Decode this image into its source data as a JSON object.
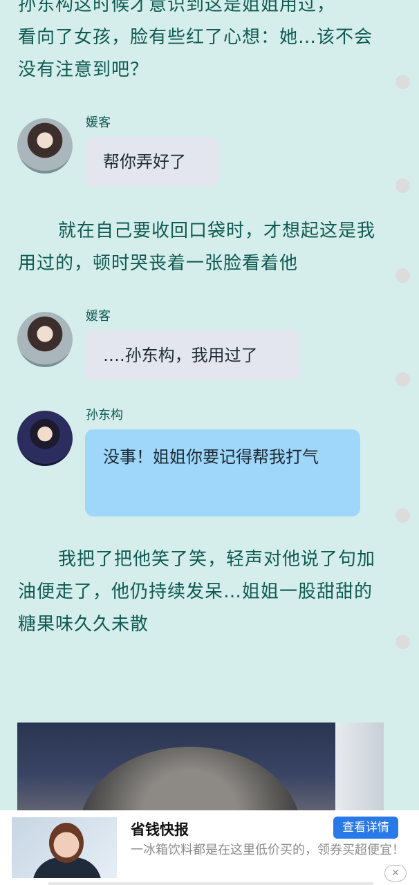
{
  "story": {
    "para_intro_partial": "孙东构这时候才意识到这是姐姐用过，",
    "para_intro_rest": "看向了女孩，脸有些红了心想：她…该不会没有注意到吧？",
    "para_2": "就在自己要收回口袋时，才想起这是我用过的，顿时哭丧着一张脸看着他",
    "para_3": "我把了把他笑了笑，轻声对他说了句加油便走了，他仍持续发呆…姐姐一股甜甜的糖果味久久未散"
  },
  "messages": [
    {
      "speaker": "媛客",
      "text": "帮你弄好了"
    },
    {
      "speaker": "媛客",
      "text": "….孙东构，我用过了"
    },
    {
      "speaker": "孙东构",
      "text": "没事！姐姐你要记得帮我打气"
    }
  ],
  "ad": {
    "title": "省钱快报",
    "button": "查看详情",
    "description": "一冰箱饮料都是在这里低价买的，领券买超便宜！",
    "close": "✕"
  }
}
